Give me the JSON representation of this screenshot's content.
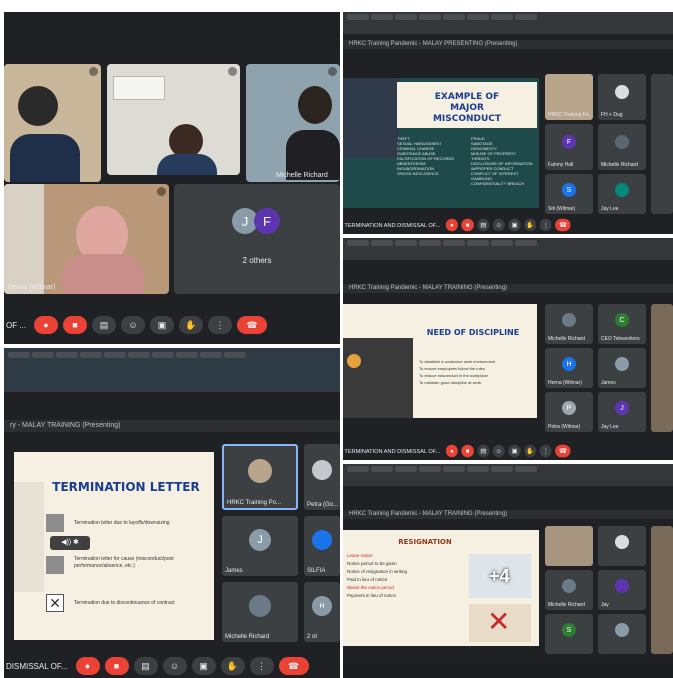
{
  "panel_a": {
    "tiles": [
      {
        "name": ""
      },
      {
        "name": ""
      },
      {
        "name": "Michelle Richard"
      },
      {
        "name": "Herna (Wilmar)"
      }
    ],
    "others": {
      "initial_1": "J",
      "initial_2": "F",
      "label": "2 others"
    },
    "meeting_label": "OF ..."
  },
  "panel_b": {
    "presenting": "HRKC Training Pandemic - MALAY PRESENTING (Presenting)",
    "slide_title": "EXAMPLE OF MAJOR MISCONDUCT",
    "left_bullets": [
      "THEFT",
      "SEXUAL HARASSMENT",
      "CRIMINAL CHARGE",
      "SUBSTANCE ABUSE",
      "FALSIFICATION OF RECORDS",
      "ABSENTEEISM",
      "INSUBORDINATION",
      "GROSS NEGLIGENCE"
    ],
    "right_bullets": [
      "FRAUD",
      "SABOTAGE",
      "DISHONESTY",
      "MISUSE OF PROPERTY",
      "THREATS",
      "DISCLOSURE OF INFORMATION",
      "IMPROPER CONDUCT",
      "CONFLICT OF INTEREST",
      "GAMBLING",
      "CONFIDENTIALITY BREACH"
    ],
    "side_tiles": [
      {
        "name": "HRKC Training Fo...",
        "initial": ""
      },
      {
        "name": "FH + Dug",
        "initial": ""
      },
      {
        "name": "Fahmy Hall",
        "initial": "F"
      },
      {
        "name": "Michelle Richard",
        "initial": ""
      },
      {
        "name": "Siti (Wilmar)",
        "initial": "S"
      },
      {
        "name": "Jay Lee",
        "initial": ""
      }
    ],
    "meeting_label": "TERMINATION AND DISMISSAL OF..."
  },
  "panel_c": {
    "presenting": "HRKC Training Pandemic - MALAY TRAINING (Presenting)",
    "slide_title": "NEED OF DISCIPLINE",
    "bullets": [
      "To establish a conducive work environment",
      "To ensure employees follow the rules",
      "To reduce misconduct in the workplace",
      "To maintain good discipline at work"
    ],
    "side_tiles": [
      {
        "name": "Michelle Richard",
        "initial": ""
      },
      {
        "name": "CEO Teleworkers",
        "initial": "C"
      },
      {
        "name": "Herna (Wilmar)",
        "initial": "H"
      },
      {
        "name": "James",
        "initial": ""
      },
      {
        "name": "Petra (Wilmar)",
        "initial": "P"
      },
      {
        "name": "Jay Lee",
        "initial": "J"
      }
    ],
    "meeting_label": "TERMINATION AND DISMISSAL OF..."
  },
  "panel_d": {
    "presenting": "ry - MALAY TRAINING (Presenting)",
    "slide_title": "TERMINATION LETTER",
    "items": [
      "Termination letter due to layoffs/downsizing",
      "Termination letter for cause (misconduct/poor performance/absence, etc.)",
      "Termination due to discontinuance of contract"
    ],
    "side_tiles": [
      {
        "name": "HRKC Training Po...",
        "initial": ""
      },
      {
        "name": "Petra (Go...",
        "initial": ""
      },
      {
        "name": "James",
        "initial": "J"
      },
      {
        "name": "SILFIA",
        "initial": ""
      },
      {
        "name": "Michelle Richard",
        "initial": ""
      },
      {
        "name": "2 ot",
        "initial": "H"
      }
    ],
    "meeting_label": "DISMISSAL OF..."
  },
  "panel_e": {
    "presenting": "HRKC Training Pandemic - MALAY TRAINING (Presenting)",
    "slide_title": "RESIGNATION",
    "bullets": [
      "Leave notice",
      "Notice period to be given",
      "Notice of resignation in writing",
      "Paid in lieu of notice",
      "Waive the notice period",
      "Payment in lieu of notice"
    ],
    "plus_count": "+4",
    "side_tiles": [
      {
        "name": "",
        "initial": ""
      },
      {
        "name": "",
        "initial": ""
      },
      {
        "name": "Michelle Richard",
        "initial": ""
      },
      {
        "name": "Jay",
        "initial": ""
      },
      {
        "name": "",
        "initial": "S"
      },
      {
        "name": "",
        "initial": ""
      }
    ]
  },
  "colors": {
    "meet_dark": "#202124",
    "tile": "#3c4043",
    "end_call": "#ea4335",
    "slide_cream": "#f5f0e1",
    "slide_teal": "#1f4a4a",
    "title_blue": "#1a3d8f",
    "avatar_gray": "#8a9ba8",
    "avatar_purple": "#5e35b1"
  }
}
